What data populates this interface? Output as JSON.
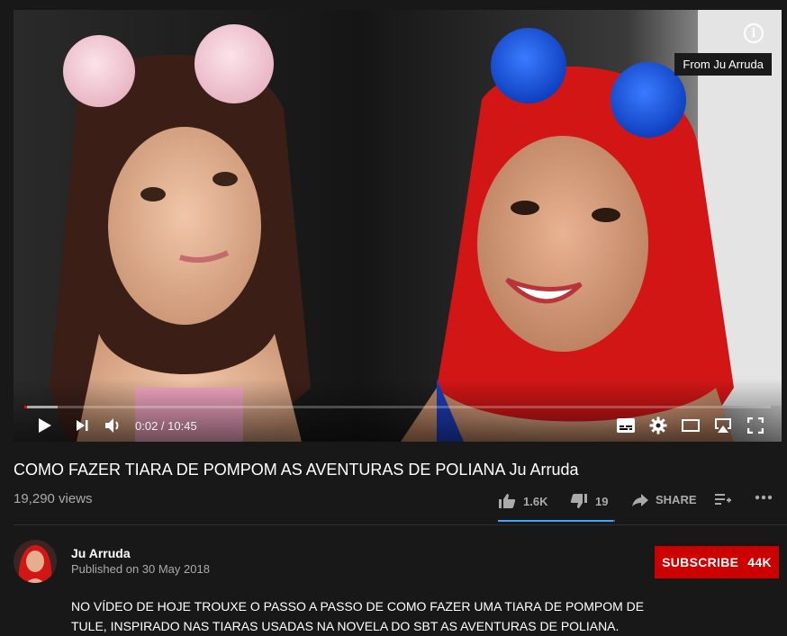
{
  "player": {
    "tooltip": "From Ju Arruda",
    "time": "0:02 / 10:45",
    "progress_fraction": 0.0032,
    "buffered_fraction": 0.045
  },
  "video": {
    "title": "COMO FAZER TIARA DE POMPOM AS AVENTURAS DE POLIANA Ju Arruda",
    "views": "19,290 views",
    "likes": "1.6K",
    "dislikes": "19",
    "share_label": "SHARE",
    "like_ratio": 0.988
  },
  "channel": {
    "name": "Ju Arruda",
    "published": "Published on 30 May 2018",
    "subscribe_label": "SUBSCRIBE",
    "subscriber_count": "44K"
  },
  "description": {
    "line1": "NO VÍDEO DE HOJE TROUXE O PASSO A PASSO DE COMO FAZER UMA TIARA DE POMPOM DE",
    "line2": "TULE, INSPIRADO NAS TIARAS USADAS NA NOVELA DO SBT AS AVENTURAS DE POLIANA."
  },
  "colors": {
    "accent": "#cc0000",
    "progress": "#ff0000",
    "like_bar": "#3ea6ff",
    "background": "#181818"
  }
}
